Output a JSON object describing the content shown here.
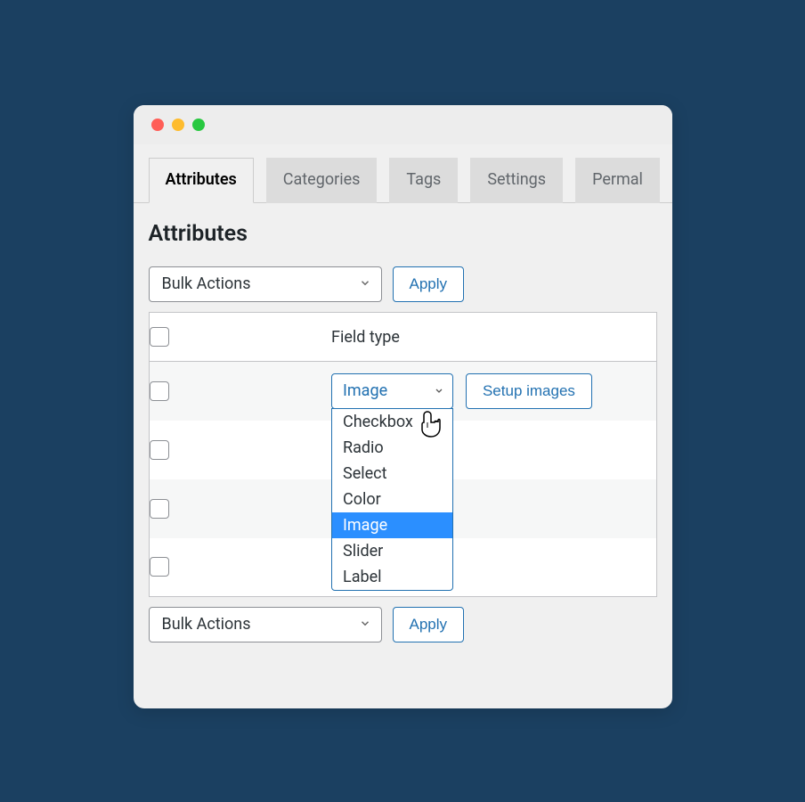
{
  "tabs": [
    {
      "label": "Attributes",
      "active": true
    },
    {
      "label": "Categories",
      "active": false
    },
    {
      "label": "Tags",
      "active": false
    },
    {
      "label": "Settings",
      "active": false
    },
    {
      "label": "Permal",
      "active": false
    }
  ],
  "page_title": "Attributes",
  "bulk_actions": {
    "label": "Bulk Actions",
    "apply": "Apply"
  },
  "table": {
    "header_field_type": "Field type",
    "field_select_value": "Image",
    "setup_images": "Setup images",
    "dropdown_options": [
      {
        "label": "Checkbox",
        "selected": false
      },
      {
        "label": "Radio",
        "selected": false
      },
      {
        "label": "Select",
        "selected": false
      },
      {
        "label": "Color",
        "selected": false
      },
      {
        "label": "Image",
        "selected": true
      },
      {
        "label": "Slider",
        "selected": false
      },
      {
        "label": "Label",
        "selected": false
      }
    ]
  }
}
